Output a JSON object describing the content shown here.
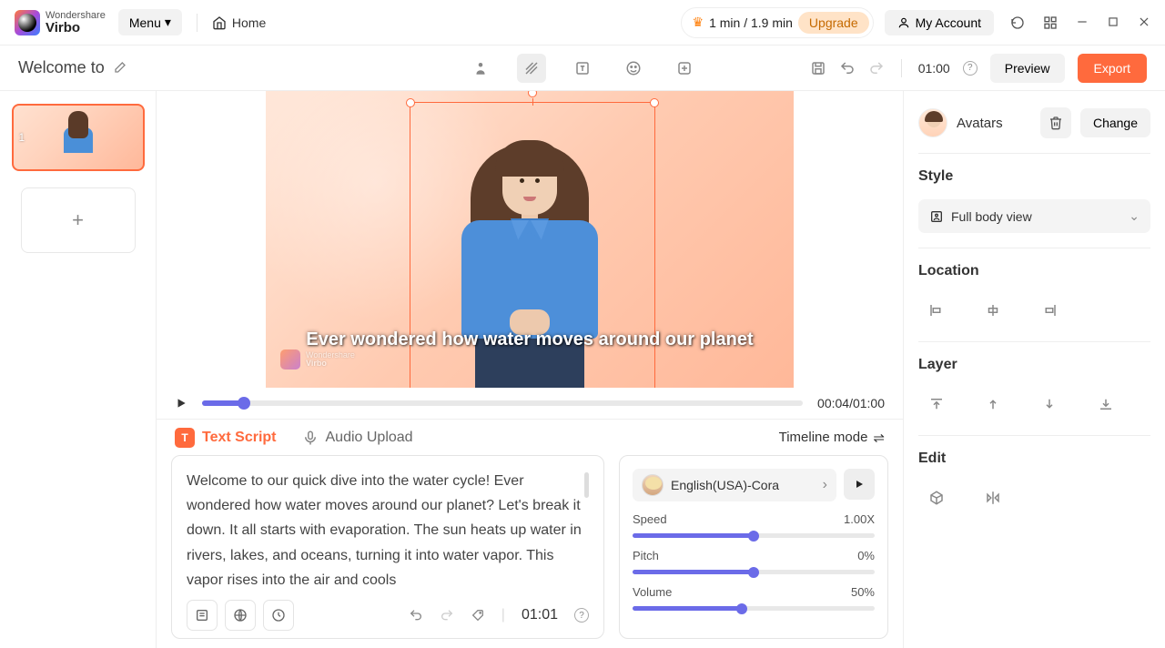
{
  "brand": {
    "top": "Wondershare",
    "name": "Virbo"
  },
  "topbar": {
    "menu": "Menu",
    "home": "Home",
    "usage": "1 min / 1.9 min",
    "upgrade": "Upgrade",
    "account": "My Account"
  },
  "project": {
    "title": "Welcome to"
  },
  "toolbar": {
    "duration": "01:00",
    "preview": "Preview",
    "export": "Export"
  },
  "slides": {
    "current_num": "1"
  },
  "canvas": {
    "subtitle": "Ever wondered how water moves around our planet",
    "watermark_top": "Wondershare",
    "watermark_bottom": "Virbo"
  },
  "player": {
    "time": "00:04/01:00"
  },
  "tabs": {
    "text_script": "Text Script",
    "audio_upload": "Audio Upload",
    "timeline_mode": "Timeline mode"
  },
  "script": {
    "text": "Welcome to our quick dive into the water cycle! Ever wondered how water moves around our planet? Let's break it down. It all starts with evaporation. The sun heats up water in rivers, lakes, and oceans, turning it into water vapor. This vapor rises into the air and cools",
    "duration": "01:01"
  },
  "voice": {
    "name": "English(USA)-Cora",
    "speed_label": "Speed",
    "speed_value": "1.00X",
    "speed_pct": 50,
    "pitch_label": "Pitch",
    "pitch_value": "0%",
    "pitch_pct": 50,
    "volume_label": "Volume",
    "volume_value": "50%",
    "volume_pct": 45
  },
  "right": {
    "avatars": "Avatars",
    "change": "Change",
    "style": "Style",
    "view_option": "Full body view",
    "location": "Location",
    "layer": "Layer",
    "edit": "Edit"
  }
}
